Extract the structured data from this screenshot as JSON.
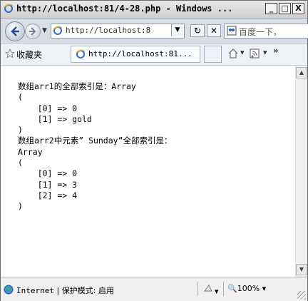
{
  "window": {
    "title": "http://localhost:81/4-28.php - Windows ...",
    "minimize": "_",
    "maximize": "□",
    "close": "X"
  },
  "nav": {
    "address": "http://localhost:8",
    "search_placeholder": "百度一下，",
    "refresh_glyph": "↻",
    "stop_glyph": "✕"
  },
  "favorites": {
    "label": "收藏夹",
    "tab_title": "http://localhost:81...",
    "chevron": "»"
  },
  "content_lines": [
    "数组arr1的全部索引是：Array",
    "(",
    "    [0] => 0",
    "    [1] => gold",
    ")",
    "数组arr2中元素” Sunday“全部索引是：",
    "Array",
    "(",
    "    [0] => 0",
    "    [1] => 3",
    "    [2] => 4",
    ")"
  ],
  "status": {
    "zone": "Internet",
    "protected_mode": "保护模式: 启用",
    "zoom": "100%"
  },
  "icons": {
    "page": "ie-page-icon",
    "back": "back-arrow-icon",
    "forward": "forward-arrow-icon",
    "search": "baidu-search-icon",
    "star": "favorites-star-icon",
    "home": "home-icon",
    "feed": "feed-icon",
    "globe": "internet-globe-icon"
  },
  "colors": {
    "accent": "#3a6fc4",
    "chrome": "#d9dee6"
  }
}
